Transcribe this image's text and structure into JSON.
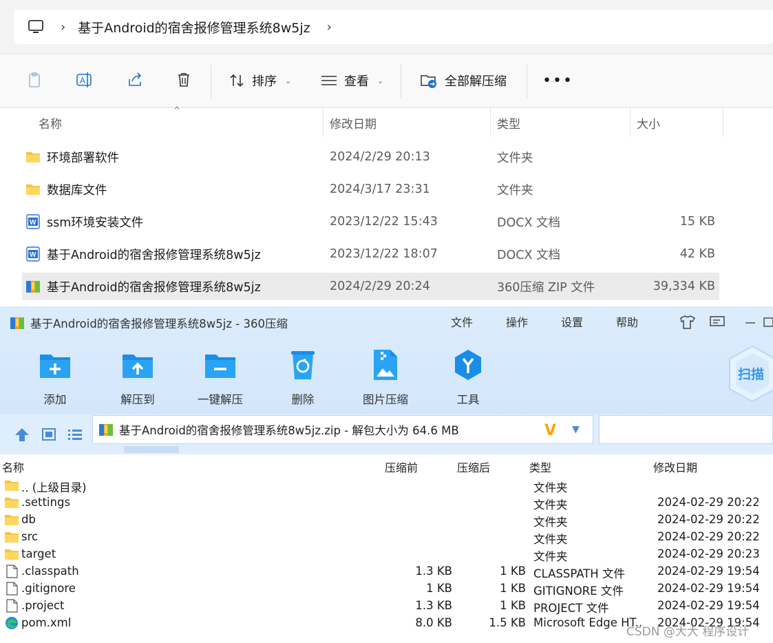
{
  "explorer": {
    "breadcrumb": "基于Android的宿舍报修管理系统8w5jz",
    "toolbar": {
      "sort_label": "排序",
      "view_label": "查看",
      "extract_all_label": "全部解压缩"
    },
    "columns": {
      "name": "名称",
      "date": "修改日期",
      "type": "类型",
      "size": "大小"
    },
    "files": [
      {
        "name": "环境部署软件",
        "date": "2024/2/29 20:13",
        "type": "文件夹",
        "size": "",
        "icon": "folder-icon"
      },
      {
        "name": "数据库文件",
        "date": "2024/3/17 23:31",
        "type": "文件夹",
        "size": "",
        "icon": "folder-icon"
      },
      {
        "name": "ssm环境安装文件",
        "date": "2023/12/22 15:43",
        "type": "DOCX 文档",
        "size": "15 KB",
        "icon": "word-doc-icon"
      },
      {
        "name": "基于Android的宿舍报修管理系统8w5jz",
        "date": "2023/12/22 18:07",
        "type": "DOCX 文档",
        "size": "42 KB",
        "icon": "word-doc-icon"
      },
      {
        "name": "基于Android的宿舍报修管理系统8w5jz",
        "date": "2024/2/29 20:24",
        "type": "360压缩 ZIP 文件",
        "size": "39,334 KB",
        "icon": "zip-archive-icon"
      }
    ]
  },
  "archive": {
    "title": "基于Android的宿舍报修管理系统8w5jz - 360压缩",
    "menu": [
      "文件",
      "操作",
      "设置",
      "帮助"
    ],
    "tools": [
      "添加",
      "解压到",
      "一键解压",
      "删除",
      "图片压缩",
      "工具"
    ],
    "scan_label": "扫描",
    "address": "基于Android的宿舍报修管理系统8w5jz.zip - 解包大小为 64.6 MB",
    "columns": {
      "name": "名称",
      "before": "压缩前",
      "after": "压缩后",
      "type": "类型",
      "date": "修改日期"
    },
    "rows": [
      {
        "name": ".. (上级目录)",
        "before": "",
        "after": "",
        "type": "文件夹",
        "date": "",
        "icon": "folder-icon"
      },
      {
        "name": ".settings",
        "before": "",
        "after": "",
        "type": "文件夹",
        "date": "2024-02-29 20:22",
        "icon": "folder-icon"
      },
      {
        "name": "db",
        "before": "",
        "after": "",
        "type": "文件夹",
        "date": "2024-02-29 20:22",
        "icon": "folder-icon"
      },
      {
        "name": "src",
        "before": "",
        "after": "",
        "type": "文件夹",
        "date": "2024-02-29 20:22",
        "icon": "folder-icon"
      },
      {
        "name": "target",
        "before": "",
        "after": "",
        "type": "文件夹",
        "date": "2024-02-29 20:23",
        "icon": "folder-icon"
      },
      {
        "name": ".classpath",
        "before": "1.3 KB",
        "after": "1 KB",
        "type": "CLASSPATH 文件",
        "date": "2024-02-29 19:54",
        "icon": "file-icon"
      },
      {
        "name": ".gitignore",
        "before": "1 KB",
        "after": "1 KB",
        "type": "GITIGNORE 文件",
        "date": "2024-02-29 19:54",
        "icon": "file-icon"
      },
      {
        "name": ".project",
        "before": "1.3 KB",
        "after": "1 KB",
        "type": "PROJECT 文件",
        "date": "2024-02-29 19:54",
        "icon": "file-icon"
      },
      {
        "name": "pom.xml",
        "before": "8.0 KB",
        "after": "1.5 KB",
        "type": "Microsoft Edge HT...",
        "date": "2024-02-29 19:54",
        "icon": "edge-icon"
      }
    ]
  },
  "watermark": "CSDN @大大 程序设计"
}
